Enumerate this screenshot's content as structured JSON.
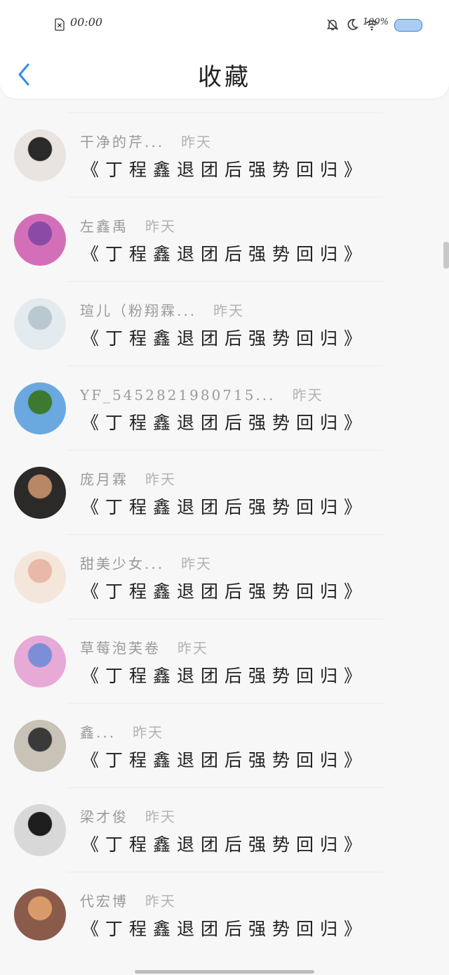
{
  "status_bar": {
    "time": "00:00",
    "battery": "100%",
    "icons": [
      "sim-x-icon",
      "bell-off-icon",
      "moon-icon",
      "wifi-icon",
      "battery-icon"
    ]
  },
  "header": {
    "title": "收藏",
    "back_icon": "chevron-left-icon"
  },
  "list": {
    "items": [
      {
        "name": "干净的芹...",
        "time": "昨天",
        "message": "《丁程鑫退团后强势回归》",
        "avatar": {
          "bg": "#e9e4e0",
          "fg": "#2a2a2a"
        }
      },
      {
        "name": "左鑫禹",
        "time": "昨天",
        "message": "《丁程鑫退团后强势回归》",
        "avatar": {
          "bg": "#d36fb8",
          "fg": "#8b4aa6"
        }
      },
      {
        "name": "瑄儿（粉翔霖...",
        "time": "昨天",
        "message": "《丁程鑫退团后强势回归》",
        "avatar": {
          "bg": "#e4ebef",
          "fg": "#b9c8d1"
        }
      },
      {
        "name": "YF_5452821980715...",
        "time": "昨天",
        "message": "《丁程鑫退团后强势回归》",
        "avatar": {
          "bg": "#6aa8e0",
          "fg": "#3d7a2f"
        }
      },
      {
        "name": "庞月霖",
        "time": "昨天",
        "message": "《丁程鑫退团后强势回归》",
        "avatar": {
          "bg": "#2c2a28",
          "fg": "#b88866"
        }
      },
      {
        "name": "甜美少女...",
        "time": "昨天",
        "message": "《丁程鑫退团后强势回归》",
        "avatar": {
          "bg": "#f5e6dc",
          "fg": "#e8b9a8"
        }
      },
      {
        "name": "草莓泡芙卷",
        "time": "昨天",
        "message": "《丁程鑫退团后强势回归》",
        "avatar": {
          "bg": "#e7a9d6",
          "fg": "#7c8fd6"
        }
      },
      {
        "name": "鑫...",
        "time": "昨天",
        "message": "《丁程鑫退团后强势回归》",
        "avatar": {
          "bg": "#c9c2b6",
          "fg": "#3a3a3a"
        }
      },
      {
        "name": "梁才俊",
        "time": "昨天",
        "message": "《丁程鑫退团后强势回归》",
        "avatar": {
          "bg": "#d8d8d8",
          "fg": "#1e1e1e"
        }
      },
      {
        "name": "代宏博",
        "time": "昨天",
        "message": "《丁程鑫退团后强势回归》",
        "avatar": {
          "bg": "#8a5a4a",
          "fg": "#d99a6a"
        }
      }
    ]
  }
}
